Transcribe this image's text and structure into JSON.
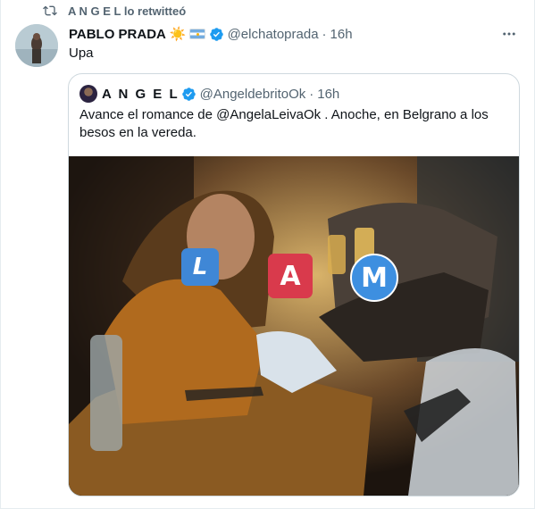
{
  "retweet": {
    "label": "A N G E L lo retwitteó",
    "icon": "retweet-icon"
  },
  "tweet": {
    "author_name": "PABLO PRADA",
    "author_emoji": "☀️",
    "author_flag": "argentina-flag-icon",
    "verified": true,
    "handle": "@elchatoprada",
    "separator": "·",
    "time": "16h",
    "text": "Upa",
    "more_icon": "more-icon"
  },
  "quoted": {
    "author_name": "A N G E L",
    "verified": true,
    "handle": "@AngeldebritoOk",
    "separator": "·",
    "time": "16h",
    "text_part1": "Avance el romance de @AngelaLeivaOk . Anoche, en Belgrano a los",
    "text_part2": "besos en la vereda.",
    "media_badges": [
      "L",
      "A",
      "M"
    ]
  },
  "colors": {
    "text_primary": "#0f1419",
    "text_secondary": "#536471",
    "verified_blue": "#1d9bf0",
    "border": "#cfd9de",
    "badge_l": "#3f87d6",
    "badge_a": "#d93a4c",
    "badge_m": "#3d8fe0"
  }
}
